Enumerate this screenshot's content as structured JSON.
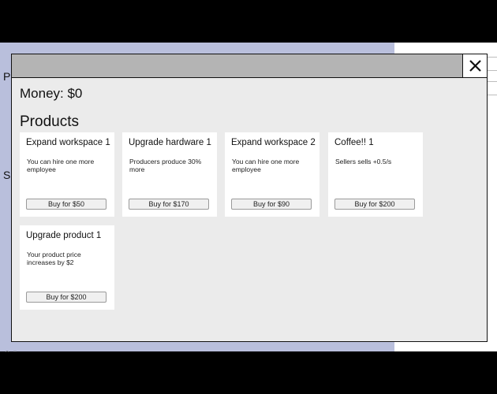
{
  "background": {
    "letter_p": "P",
    "letter_s": "S",
    "bottom_text": "Sellers"
  },
  "modal": {
    "close_label": "X",
    "money_label": "Money: $0",
    "products_heading": "Products",
    "products": [
      {
        "title": "Expand workspace 1",
        "description": "You can hire one more employee",
        "buy_label": "Buy for $50"
      },
      {
        "title": "Upgrade hardware 1",
        "description": "Producers produce 30% more",
        "buy_label": "Buy for $170"
      },
      {
        "title": "Expand workspace 2",
        "description": "You can hire one more employee",
        "buy_label": "Buy for $90"
      },
      {
        "title": "Coffee!! 1",
        "description": "Sellers sells +0.5/s",
        "buy_label": "Buy for $200"
      },
      {
        "title": "Upgrade product 1",
        "description": "Your product price increases by $2",
        "buy_label": "Buy for $200"
      }
    ]
  }
}
